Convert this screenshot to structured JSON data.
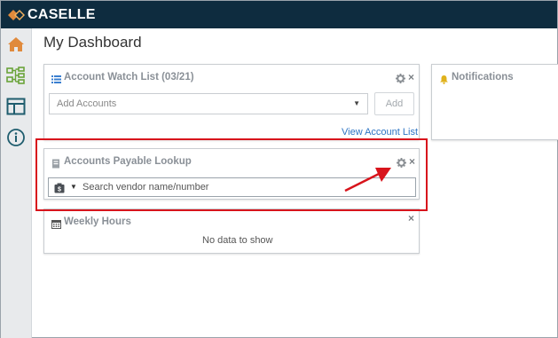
{
  "brand": {
    "name": "CASELLE"
  },
  "sidebar": {
    "items": [
      {
        "icon": "home-icon"
      },
      {
        "icon": "org-chart-icon"
      },
      {
        "icon": "layout-icon"
      },
      {
        "icon": "info-icon"
      }
    ]
  },
  "page": {
    "title": "My Dashboard"
  },
  "widgets": {
    "account_watch": {
      "title": "Account Watch List (03/21)",
      "select_placeholder": "Add Accounts",
      "add_label": "Add",
      "link_label": "View Account List"
    },
    "notifications": {
      "title": "Notifications"
    },
    "ap_lookup": {
      "title": "Accounts Payable Lookup",
      "search_placeholder": "Search vendor name/number"
    },
    "weekly_hours": {
      "title": "Weekly Hours",
      "empty_text": "No data to show"
    }
  },
  "colors": {
    "header_bg": "#0e2c3f",
    "accent_orange": "#e08a3c",
    "sidebar_green": "#6aa33a",
    "highlight_red": "#d8141c",
    "link_blue": "#2d74c4"
  }
}
